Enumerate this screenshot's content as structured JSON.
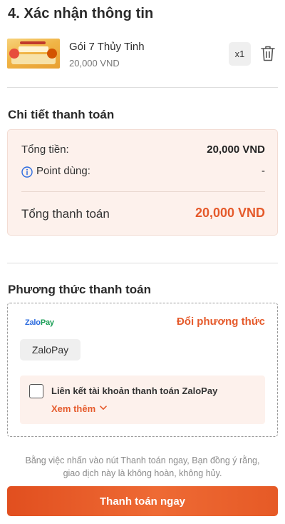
{
  "header": {
    "title": "4. Xác nhận thông tin"
  },
  "product": {
    "name": "Gói 7 Thủy Tinh",
    "price": "20,000 VND",
    "quantity": "x1",
    "thumbnail_icon": "product-thumbnail-image",
    "delete_icon": "trash-icon"
  },
  "payment_detail": {
    "title": "Chi tiết thanh toán",
    "subtotal_label": "Tổng tiền:",
    "subtotal_value": "20,000 VND",
    "points_label": "Point dùng:",
    "points_value": "-",
    "total_label": "Tổng thanh toán",
    "total_value": "20,000 VND"
  },
  "payment_method": {
    "title": "Phương thức thanh toán",
    "logo_text_a": "Zalo",
    "logo_text_b": "Pay",
    "change_label": "Đổi phương thức",
    "selected": "ZaloPay",
    "link_label": "Liên kết tài khoản thanh toán ZaloPay",
    "more_label": "Xem thêm"
  },
  "footer": {
    "disclaimer_line1": "Bằng việc nhấn vào nút Thanh toán ngay, Bạn đồng ý rằng,",
    "disclaimer_line2": "giao dịch này là không hoàn, không hủy.",
    "pay_button": "Thanh toán ngay"
  },
  "colors": {
    "accent": "#e55a2b",
    "summary_bg": "#fdf1ec",
    "zalo_blue": "#2d6cdf",
    "zalo_green": "#1a9e55"
  }
}
